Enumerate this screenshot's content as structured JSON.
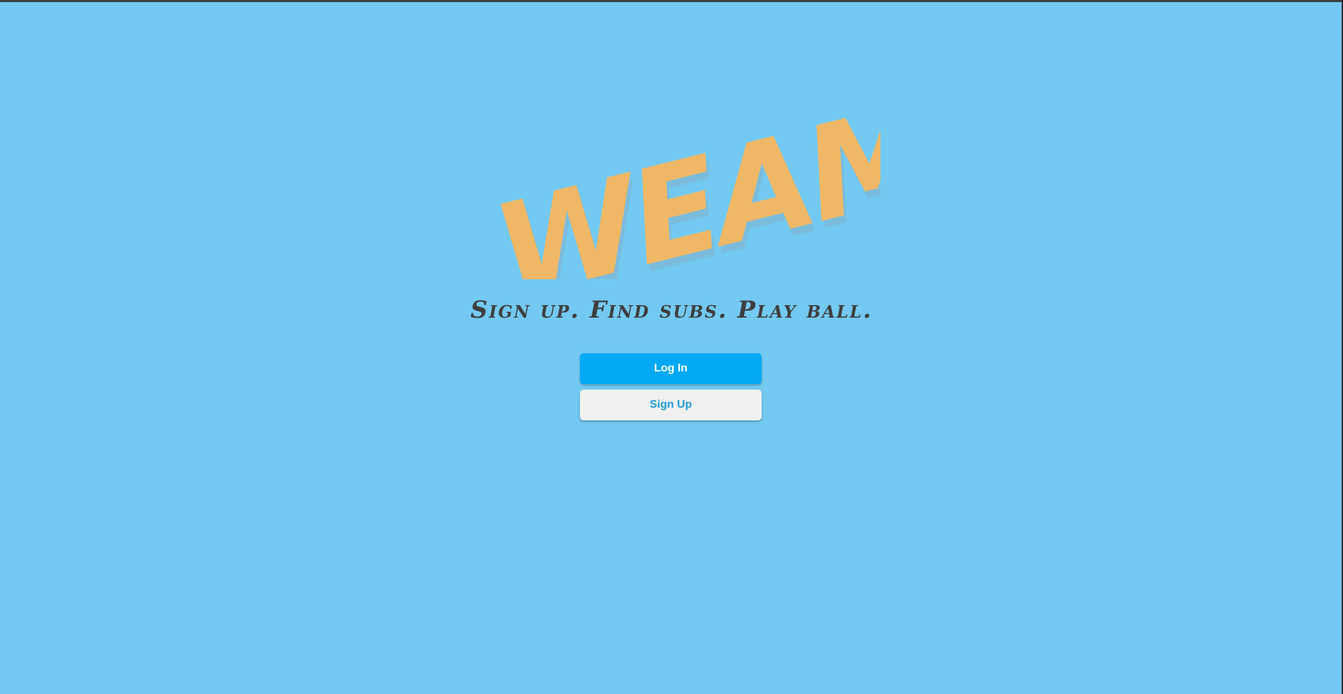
{
  "brand": {
    "logo_text": "WEAM",
    "logo_color": "#f0b866"
  },
  "tagline": "Sign up. Find subs. Play ball.",
  "actions": {
    "login_label": "Log In",
    "signup_label": "Sign Up"
  },
  "colors": {
    "background": "#73c9f1",
    "primary": "#03a9f4",
    "secondary_bg": "#f0f0f0",
    "tagline": "#3e3e3e"
  }
}
